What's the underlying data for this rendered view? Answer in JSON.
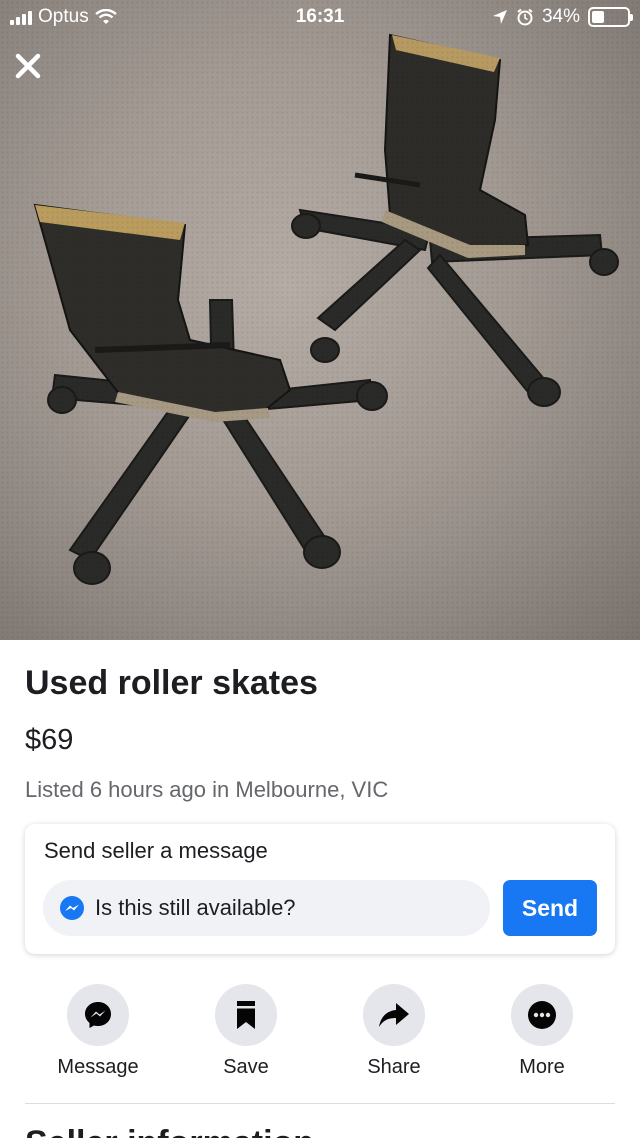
{
  "status_bar": {
    "carrier": "Optus",
    "time": "16:31",
    "battery": "34%",
    "battery_level": 0.34
  },
  "listing": {
    "title": "Used roller skates",
    "price": "$69",
    "listed": "Listed 6 hours ago in Melbourne, VIC"
  },
  "message_card": {
    "title": "Send seller a message",
    "input_value": "Is this still available?",
    "send_label": "Send"
  },
  "actions": [
    {
      "label": "Message",
      "icon": "messenger-icon"
    },
    {
      "label": "Save",
      "icon": "bookmark-icon"
    },
    {
      "label": "Share",
      "icon": "share-arrow-icon"
    },
    {
      "label": "More",
      "icon": "more-dots-icon"
    }
  ],
  "next_section": {
    "heading": "Seller information"
  },
  "colors": {
    "accent": "#1877f2",
    "action_circle": "#e4e6eb",
    "secondary_text": "#65676b"
  }
}
